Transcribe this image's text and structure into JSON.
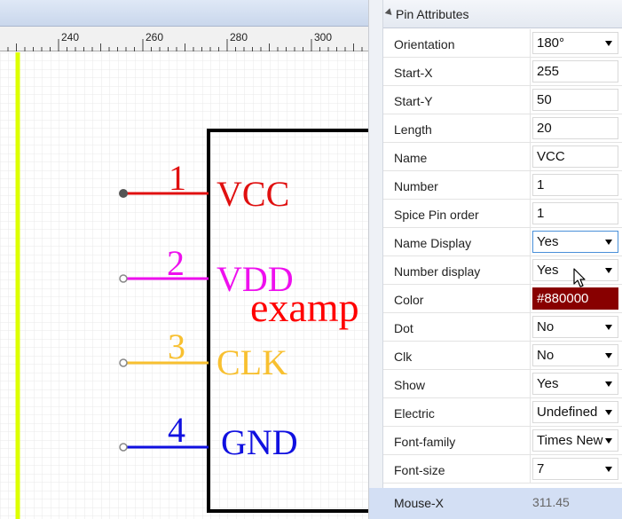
{
  "ruler": {
    "ticks": [
      "240",
      "260",
      "280",
      "300"
    ]
  },
  "symbol": {
    "body_text": "examp",
    "pins": [
      {
        "number": "1",
        "name": "VCC",
        "color": "#e01010"
      },
      {
        "number": "2",
        "name": "VDD",
        "color": "#ee10ee"
      },
      {
        "number": "3",
        "name": "CLK",
        "color": "#f8c030"
      },
      {
        "number": "4",
        "name": "GND",
        "color": "#1010e0"
      }
    ]
  },
  "panel": {
    "title": "Pin Attributes",
    "rows": [
      {
        "label": "Orientation",
        "value": "180°",
        "type": "select"
      },
      {
        "label": "Start-X",
        "value": "255",
        "type": "text"
      },
      {
        "label": "Start-Y",
        "value": "50",
        "type": "text"
      },
      {
        "label": "Length",
        "value": "20",
        "type": "text"
      },
      {
        "label": "Name",
        "value": "VCC",
        "type": "text"
      },
      {
        "label": "Number",
        "value": "1",
        "type": "text"
      },
      {
        "label": "Spice Pin order",
        "value": "1",
        "type": "text"
      },
      {
        "label": "Name Display",
        "value": "Yes",
        "type": "select"
      },
      {
        "label": "Number display",
        "value": "Yes",
        "type": "select"
      },
      {
        "label": "Color",
        "value": "#880000",
        "type": "color"
      },
      {
        "label": "Dot",
        "value": "No",
        "type": "select"
      },
      {
        "label": "Clk",
        "value": "No",
        "type": "select"
      },
      {
        "label": "Show",
        "value": "Yes",
        "type": "select"
      },
      {
        "label": "Electric",
        "value": "Undefined",
        "type": "select"
      },
      {
        "label": "Font-family",
        "value": "Times New Roman",
        "type": "select"
      },
      {
        "label": "Font-size",
        "value": "7",
        "type": "select"
      }
    ],
    "status": {
      "label": "Mouse-X",
      "value": "311.45"
    }
  },
  "colors": {
    "accent_line": "#ddff00",
    "color_swatch": "#880000",
    "focus_border": "#4a90d9",
    "status_bg": "#d3dff4"
  }
}
